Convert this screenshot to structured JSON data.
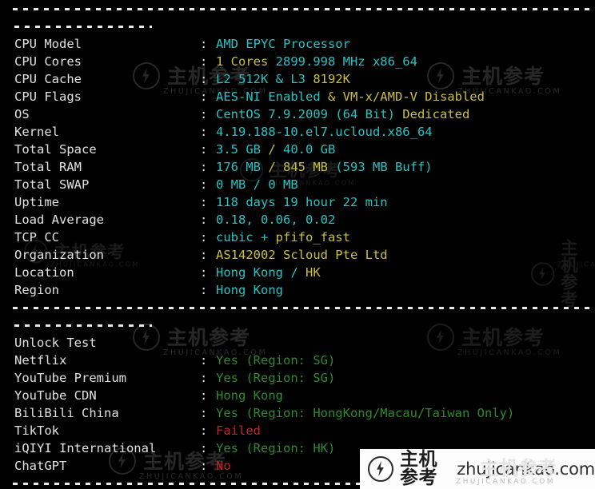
{
  "terminal": {
    "background": "#010101",
    "colors": {
      "label": "#e2e2e2",
      "cyan": "#25c4c4",
      "yellow": "#cbbf3f",
      "green": "#2d8a2d",
      "red": "#c62128"
    },
    "separators": {
      "full_dashes": "------------------------------------------------------------------------",
      "short_dashes": "--------------"
    }
  },
  "system_info": {
    "rows": [
      {
        "label": "CPU Model",
        "colon": ":",
        "parts": [
          {
            "text": "AMD EPYC Processor",
            "color": "cyan"
          }
        ]
      },
      {
        "label": "CPU Cores",
        "colon": ":",
        "parts": [
          {
            "text": "1 Cores ",
            "color": "yellow"
          },
          {
            "text": "2899.998 MHz x86_64",
            "color": "cyan"
          }
        ]
      },
      {
        "label": "CPU Cache",
        "colon": ":",
        "parts": [
          {
            "text": "L2 512K & L3 ",
            "color": "cyan"
          },
          {
            "text": "8192K",
            "color": "yellow"
          }
        ]
      },
      {
        "label": "CPU Flags",
        "colon": ":",
        "parts": [
          {
            "text": "AES-NI Enabled ",
            "color": "cyan"
          },
          {
            "text": "& VM-x/AMD-V Disabled",
            "color": "yellow"
          }
        ]
      },
      {
        "label": "OS",
        "colon": ":",
        "parts": [
          {
            "text": "CentOS 7.9.2009 (64 Bit) ",
            "color": "cyan"
          },
          {
            "text": "Dedicated",
            "color": "yellow"
          }
        ]
      },
      {
        "label": "Kernel",
        "colon": ":",
        "parts": [
          {
            "text": "4.19.188-10.el7.ucloud.x86_64",
            "color": "cyan"
          }
        ]
      },
      {
        "label": "Total Space",
        "colon": ":",
        "parts": [
          {
            "text": "3.5 GB ",
            "color": "cyan"
          },
          {
            "text": "/ ",
            "color": "yellow"
          },
          {
            "text": "40.0 GB",
            "color": "cyan"
          }
        ]
      },
      {
        "label": "Total RAM",
        "colon": ":",
        "parts": [
          {
            "text": "176 MB ",
            "color": "cyan"
          },
          {
            "text": "/ 845 MB ",
            "color": "yellow"
          },
          {
            "text": "(593 MB Buff)",
            "color": "cyan"
          }
        ]
      },
      {
        "label": "Total SWAP",
        "colon": ":",
        "parts": [
          {
            "text": "0 MB / 0 MB",
            "color": "cyan"
          }
        ]
      },
      {
        "label": "Uptime",
        "colon": ":",
        "parts": [
          {
            "text": "118 days 19 hour 22 min",
            "color": "cyan"
          }
        ]
      },
      {
        "label": "Load Average",
        "colon": ":",
        "parts": [
          {
            "text": "0.18, 0.06, 0.02",
            "color": "cyan"
          }
        ]
      },
      {
        "label": "TCP CC",
        "colon": ":",
        "parts": [
          {
            "text": "cubic + ",
            "color": "cyan"
          },
          {
            "text": "pfifo_fast",
            "color": "yellow"
          }
        ]
      },
      {
        "label": "Organization",
        "colon": ":",
        "parts": [
          {
            "text": "AS142002 Scloud Pte Ltd",
            "color": "yellow"
          }
        ]
      },
      {
        "label": "Location",
        "colon": ":",
        "parts": [
          {
            "text": "Hong Kong / ",
            "color": "cyan"
          },
          {
            "text": "HK",
            "color": "yellow"
          }
        ]
      },
      {
        "label": "Region",
        "colon": ":",
        "parts": [
          {
            "text": "Hong Kong",
            "color": "cyan"
          }
        ]
      }
    ]
  },
  "unlock_test": {
    "header": "Unlock Test",
    "rows": [
      {
        "label": "Netflix",
        "colon": ":",
        "parts": [
          {
            "text": "Yes (Region: SG)",
            "color": "green"
          }
        ]
      },
      {
        "label": "YouTube Premium",
        "colon": ":",
        "parts": [
          {
            "text": "Yes (Region: SG)",
            "color": "green"
          }
        ]
      },
      {
        "label": "YouTube CDN",
        "colon": ":",
        "parts": [
          {
            "text": "Hong Kong",
            "color": "green"
          }
        ]
      },
      {
        "label": "BiliBili China",
        "colon": ":",
        "parts": [
          {
            "text": "Yes (Region: HongKong/Macau/Taiwan Only)",
            "color": "green"
          }
        ]
      },
      {
        "label": "TikTok",
        "colon": ":",
        "parts": [
          {
            "text": "Failed",
            "color": "red"
          }
        ]
      },
      {
        "label": "iQIYI International",
        "colon": ":",
        "parts": [
          {
            "text": "Yes (Region: HK)",
            "color": "green"
          }
        ]
      },
      {
        "label": "ChatGPT",
        "colon": ":",
        "parts": [
          {
            "text": "No",
            "color": "red"
          }
        ]
      }
    ]
  },
  "watermarks": {
    "brand_cn": "主机参考",
    "brand_sub": "ZHUJICANKAO.COM",
    "badge_domain": "zhujicankao.com",
    "badge_ghost": "主机参考"
  }
}
